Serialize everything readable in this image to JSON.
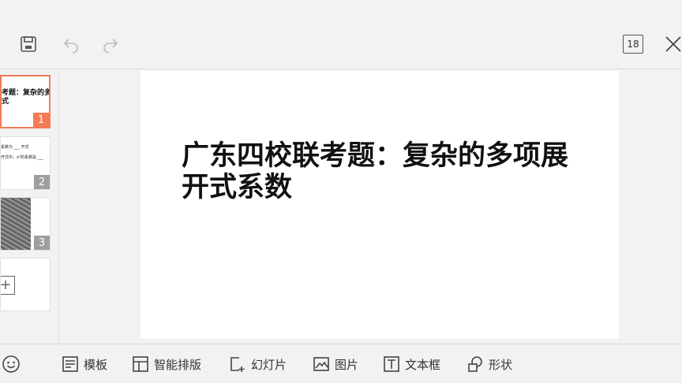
{
  "topbar": {
    "save_icon": "save-icon",
    "undo_icon": "undo-icon",
    "redo_icon": "redo-icon",
    "slide_count": "18",
    "close_icon": "close-icon"
  },
  "thumbnails": [
    {
      "number": "1",
      "text_line1": "考题：复杂的多",
      "text_line2": "式",
      "active": true
    },
    {
      "number": "2",
      "line1": "系数为 ___ 开式",
      "line2": "开式中，x²的系数是 ___"
    },
    {
      "number": "3"
    },
    {
      "label": "+",
      "icon": "add-slide-icon"
    }
  ],
  "slide": {
    "title": "广东四校联考题：复杂的多项展开式系数"
  },
  "toolbar": {
    "emoji_icon": "emoji-icon",
    "items": [
      {
        "label": "模板",
        "icon": "template-icon"
      },
      {
        "label": "智能排版",
        "icon": "layout-icon"
      },
      {
        "label": "幻灯片",
        "icon": "add-slide-icon"
      },
      {
        "label": "图片",
        "icon": "picture-icon"
      },
      {
        "label": "文本框",
        "icon": "textbox-icon"
      },
      {
        "label": "形状",
        "icon": "shape-icon"
      }
    ]
  }
}
